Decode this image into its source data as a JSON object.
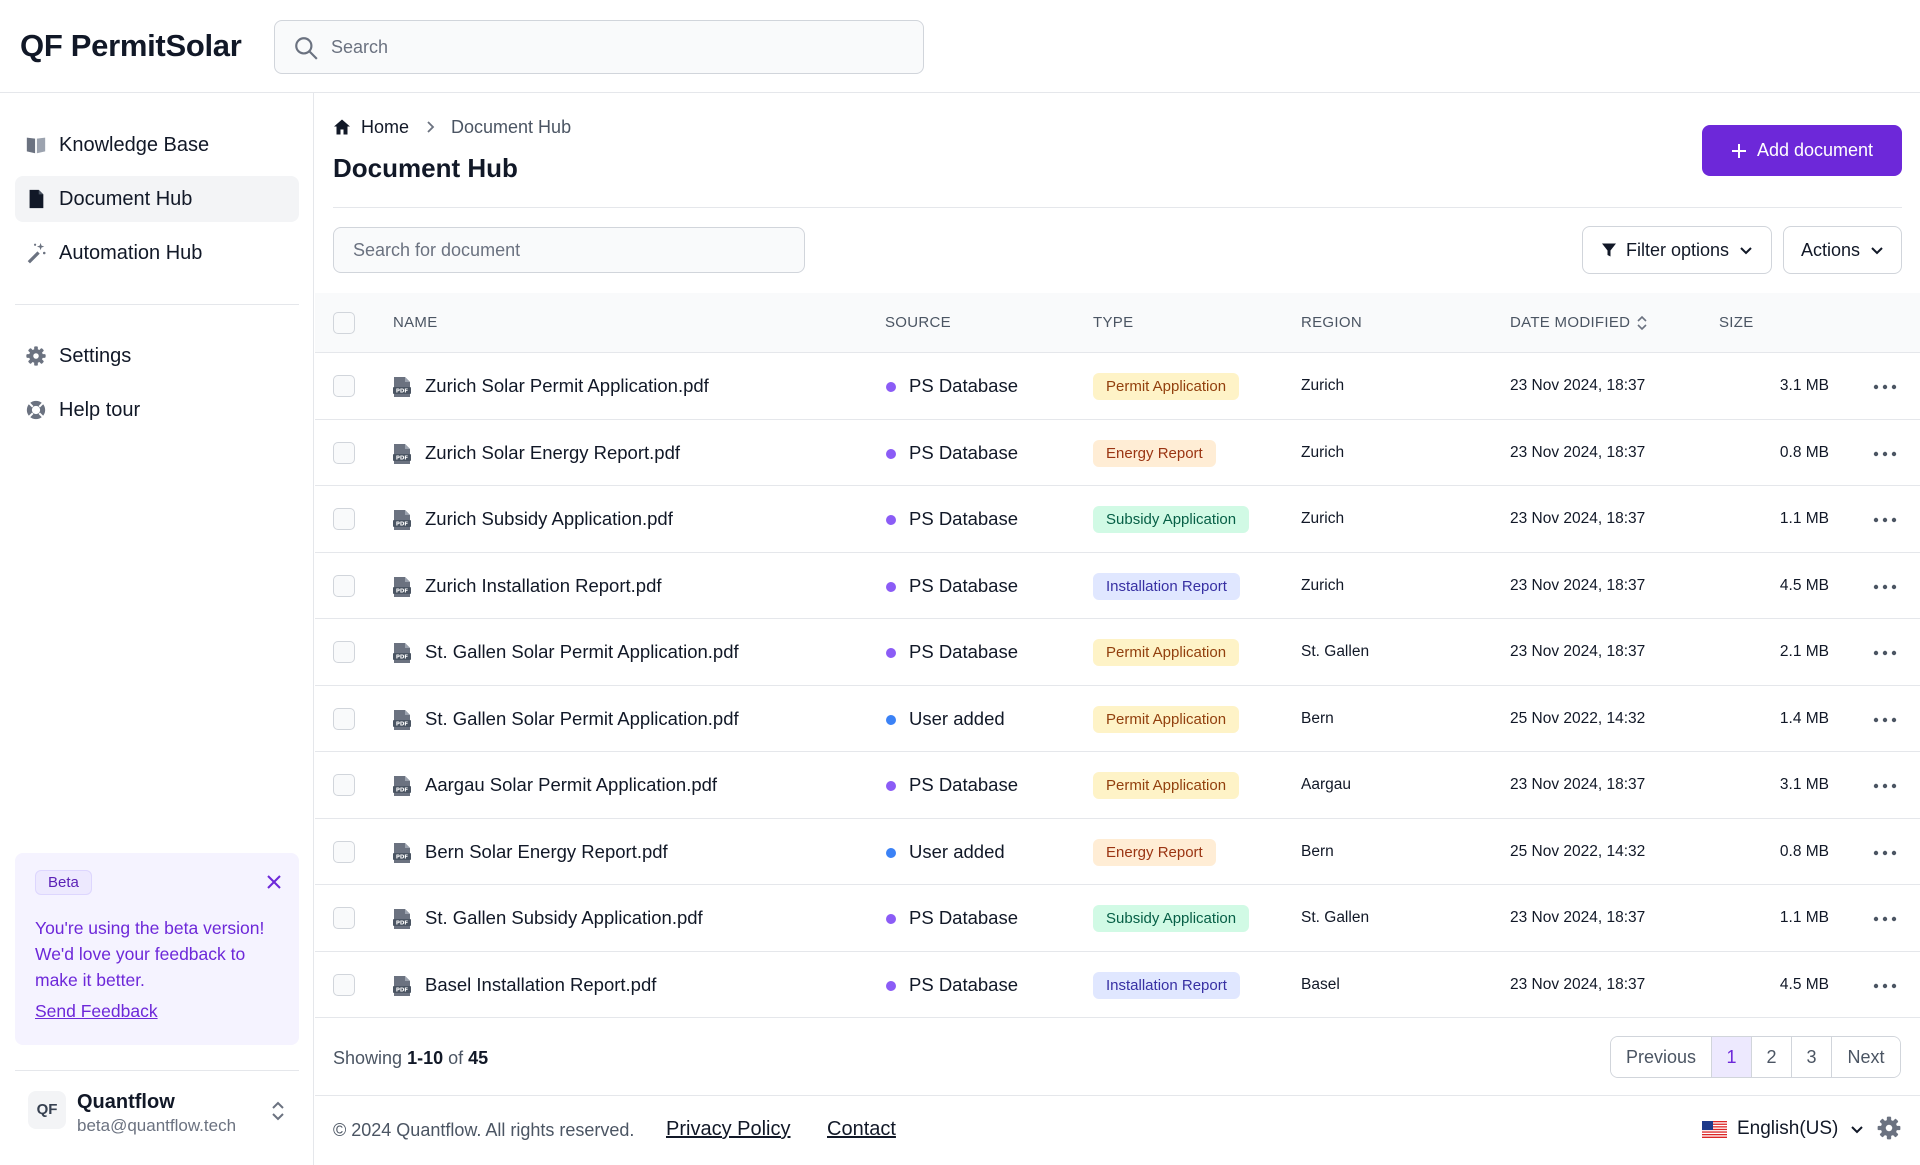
{
  "app": {
    "title": "QF PermitSolar",
    "search_placeholder": "Search"
  },
  "sidebar": {
    "items": [
      {
        "label": "Knowledge Base",
        "icon": "book-icon"
      },
      {
        "label": "Document Hub",
        "icon": "document-icon",
        "active": true
      },
      {
        "label": "Automation Hub",
        "icon": "magic-wand-icon"
      }
    ],
    "secondary": [
      {
        "label": "Settings",
        "icon": "gear-icon"
      },
      {
        "label": "Help tour",
        "icon": "lifebuoy-icon"
      }
    ],
    "beta": {
      "badge": "Beta",
      "message": "You're using the beta version! We'd love your feedback to make it better.",
      "link": "Send Feedback"
    },
    "user": {
      "initials": "QF",
      "name": "Quantflow",
      "email": "beta@quantflow.tech"
    }
  },
  "breadcrumb": {
    "home": "Home",
    "current": "Document Hub"
  },
  "page": {
    "title": "Document Hub",
    "add_button": "Add document",
    "doc_search_placeholder": "Search for document",
    "filter_button": "Filter options",
    "actions_button": "Actions"
  },
  "table": {
    "columns": {
      "name": "NAME",
      "source": "SOURCE",
      "type": "TYPE",
      "region": "REGION",
      "date": "DATE MODIFIED",
      "size": "SIZE"
    },
    "rows": [
      {
        "name": "Zurich Solar Permit Application.pdf",
        "source": "PS Database",
        "type": "Permit Application",
        "region": "Zurich",
        "date": "23 Nov 2024, 18:37",
        "size": "3.1 MB"
      },
      {
        "name": "Zurich Solar Energy Report.pdf",
        "source": "PS Database",
        "type": "Energy Report",
        "region": "Zurich",
        "date": "23 Nov 2024, 18:37",
        "size": "0.8 MB"
      },
      {
        "name": "Zurich Subsidy Application.pdf",
        "source": "PS Database",
        "type": "Subsidy Application",
        "region": "Zurich",
        "date": "23 Nov 2024, 18:37",
        "size": "1.1 MB"
      },
      {
        "name": "Zurich Installation Report.pdf",
        "source": "PS Database",
        "type": "Installation Report",
        "region": "Zurich",
        "date": "23 Nov 2024, 18:37",
        "size": "4.5 MB"
      },
      {
        "name": "St. Gallen Solar Permit Application.pdf",
        "source": "PS Database",
        "type": "Permit Application",
        "region": "St. Gallen",
        "date": "23 Nov 2024, 18:37",
        "size": "2.1 MB"
      },
      {
        "name": "St. Gallen Solar Permit Application.pdf",
        "source": "User added",
        "type": "Permit Application",
        "region": "Bern",
        "date": "25 Nov 2022, 14:32",
        "size": "1.4 MB"
      },
      {
        "name": "Aargau Solar Permit Application.pdf",
        "source": "PS Database",
        "type": "Permit Application",
        "region": "Aargau",
        "date": "23 Nov 2024, 18:37",
        "size": "3.1 MB"
      },
      {
        "name": "Bern Solar Energy Report.pdf",
        "source": "User added",
        "type": "Energy Report",
        "region": "Bern",
        "date": "25 Nov 2022, 14:32",
        "size": "0.8 MB"
      },
      {
        "name": "St. Gallen Subsidy Application.pdf",
        "source": "PS Database",
        "type": "Subsidy Application",
        "region": "St. Gallen",
        "date": "23 Nov 2024, 18:37",
        "size": "1.1 MB"
      },
      {
        "name": "Basel Installation Report.pdf",
        "source": "PS Database",
        "type": "Installation Report",
        "region": "Basel",
        "date": "23 Nov 2024, 18:37",
        "size": "4.5 MB"
      }
    ]
  },
  "pagination": {
    "showing_prefix": "Showing",
    "range": "1-10",
    "of": "of",
    "total": "45",
    "previous": "Previous",
    "pages": [
      "1",
      "2",
      "3"
    ],
    "current_page": "1",
    "next": "Next"
  },
  "footer": {
    "copyright": "© 2024 Quantflow. All rights reserved.",
    "privacy": "Privacy Policy",
    "contact": "Contact",
    "language": "English(US)"
  },
  "colors": {
    "accent": "#6d28d9",
    "source_ps_database": "#8b5cf6",
    "source_user_added": "#3b82f6",
    "type_permit_bg": "#fef3c7",
    "type_permit_fg": "#92400e",
    "type_energy_bg": "#ffedd5",
    "type_energy_fg": "#9a3412",
    "type_subsidy_bg": "#d1fae5",
    "type_subsidy_fg": "#065f46",
    "type_install_bg": "#e0e7ff",
    "type_install_fg": "#3730a3"
  }
}
